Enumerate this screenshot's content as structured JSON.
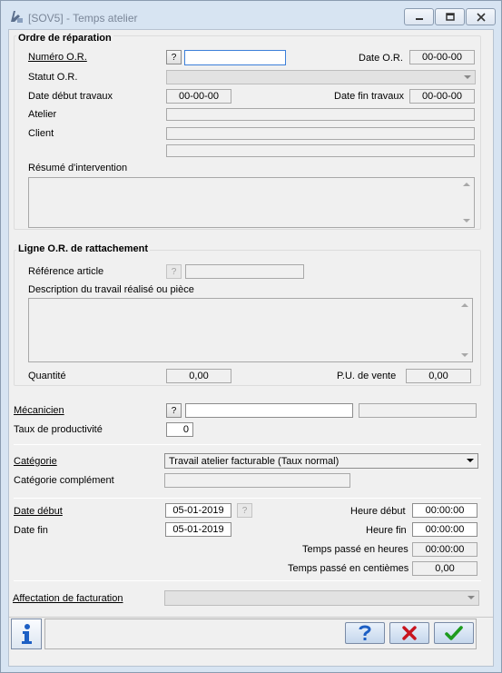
{
  "window": {
    "title": "[SOV5] - Temps atelier"
  },
  "ordre": {
    "section_title": "Ordre de réparation",
    "numero_label": "Numéro O.R.",
    "numero_value": "",
    "help_label": "?",
    "date_or_label": "Date O.R.",
    "date_or_value": "00-00-00",
    "statut_label": "Statut O.R.",
    "statut_value": "",
    "date_debut_travaux_label": "Date début travaux",
    "date_debut_travaux_value": "00-00-00",
    "date_fin_travaux_label": "Date fin travaux",
    "date_fin_travaux_value": "00-00-00",
    "atelier_label": "Atelier",
    "atelier_value": "",
    "client_label": "Client",
    "client_value": "",
    "client_value2": "",
    "resume_label": "Résumé d'intervention",
    "resume_value": ""
  },
  "ligne": {
    "section_title": "Ligne O.R. de rattachement",
    "reference_label": "Référence article",
    "reference_value": "",
    "help_label": "?",
    "description_label": "Description du travail réalisé ou pièce",
    "description_value": "",
    "quantite_label": "Quantité",
    "quantite_value": "0,00",
    "pu_label": "P.U. de vente",
    "pu_value": "0,00"
  },
  "mecanicien": {
    "label": "Mécanicien",
    "help_label": "?",
    "value": "",
    "name_value": "",
    "taux_label": "Taux de productivité",
    "taux_value": "0"
  },
  "categorie": {
    "label": "Catégorie",
    "value": "Travail atelier facturable (Taux normal)",
    "complement_label": "Catégorie complément",
    "complement_value": ""
  },
  "temps": {
    "date_debut_label": "Date début",
    "date_debut_value": "05-01-2019",
    "help_label": "?",
    "date_fin_label": "Date fin",
    "date_fin_value": "05-01-2019",
    "heure_debut_label": "Heure début",
    "heure_debut_value": "00:00:00",
    "heure_fin_label": "Heure fin",
    "heure_fin_value": "00:00:00",
    "passe_heures_label": "Temps passé en heures",
    "passe_heures_value": "00:00:00",
    "passe_centiemes_label": "Temps passé en centièmes",
    "passe_centiemes_value": "0,00"
  },
  "affectation": {
    "label": "Affectation de facturation",
    "value": ""
  },
  "icons": {
    "app": "app-icon",
    "minimize": "minimize-icon",
    "maximize": "maximize-icon",
    "close": "close-icon",
    "info": "info-icon",
    "help": "question-icon",
    "cancel": "red-x-icon",
    "ok": "green-check-icon"
  },
  "colors": {
    "titlebar": "#d7e4f2",
    "form_bg": "#f0f0f0",
    "focus_border": "#3c7fd9",
    "cancel_red": "#c8141e",
    "ok_green": "#1e9b1e",
    "help_blue": "#1d5fc4"
  }
}
